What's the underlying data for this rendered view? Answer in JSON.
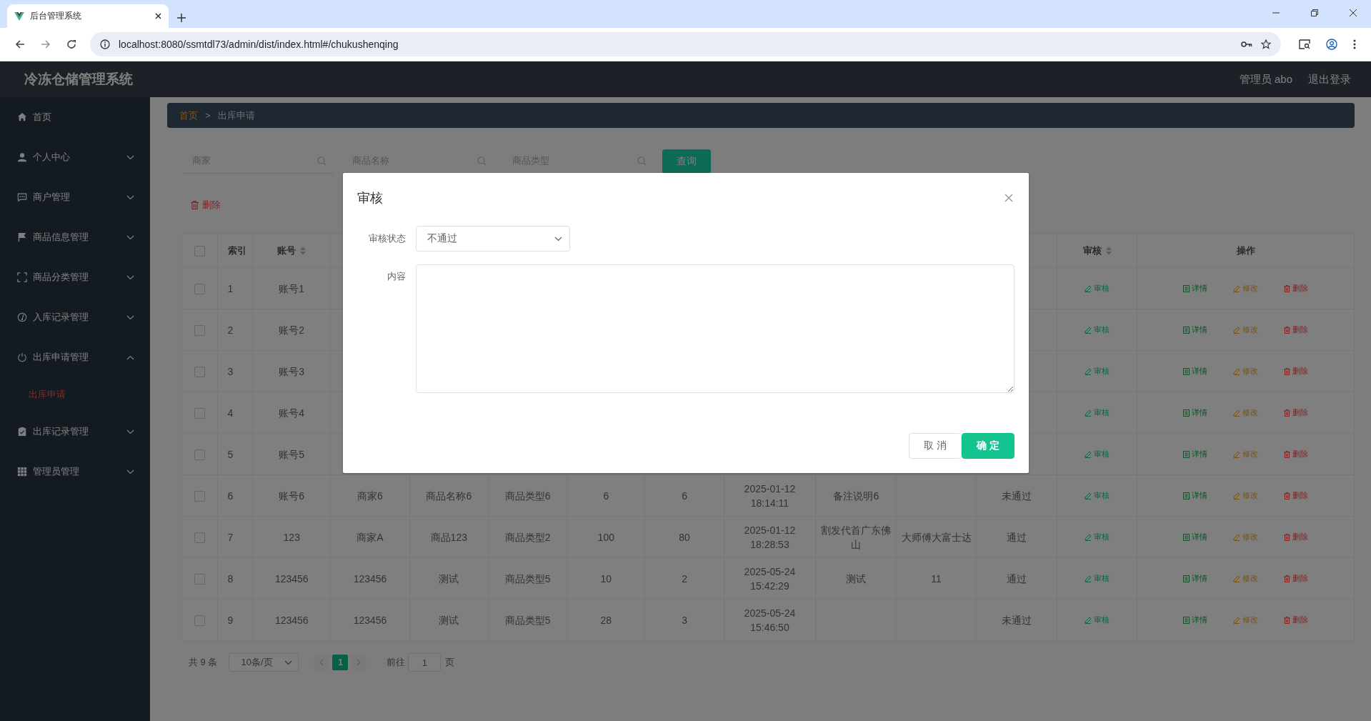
{
  "browser": {
    "tab_title": "后台管理系统",
    "url": "localhost:8080/ssmtdl73/admin/dist/index.html#/chukushenqing"
  },
  "header": {
    "title": "冷冻仓储管理系统",
    "user": "管理员 abo",
    "logout": "退出登录"
  },
  "sidebar": {
    "items": [
      {
        "label": "首页",
        "kind": "link"
      },
      {
        "label": "个人中心",
        "kind": "menu",
        "expanded": false
      },
      {
        "label": "商户管理",
        "kind": "menu",
        "expanded": false
      },
      {
        "label": "商品信息管理",
        "kind": "menu",
        "expanded": false
      },
      {
        "label": "商品分类管理",
        "kind": "menu",
        "expanded": false
      },
      {
        "label": "入库记录管理",
        "kind": "menu",
        "expanded": false
      },
      {
        "label": "出库申请管理",
        "kind": "menu",
        "expanded": true,
        "children": [
          {
            "label": "出库申请",
            "selected": true
          }
        ]
      },
      {
        "label": "出库记录管理",
        "kind": "menu",
        "expanded": false
      },
      {
        "label": "管理员管理",
        "kind": "menu",
        "expanded": false
      }
    ]
  },
  "breadcrumb": {
    "separator": ">",
    "items": [
      {
        "label": "首页",
        "selected": false
      },
      {
        "label": "出库申请",
        "selected": true
      }
    ]
  },
  "search": {
    "fields": [
      {
        "placeholder": "商家"
      },
      {
        "placeholder": "商品名称"
      },
      {
        "placeholder": "商品类型"
      }
    ],
    "button": "查询"
  },
  "toolbar": {
    "delete": "删除"
  },
  "table": {
    "header_checked": false,
    "columns": [
      {
        "label": "索引",
        "sortable": false
      },
      {
        "label": "账号",
        "sortable": true
      }
    ],
    "trailing_columns": [
      {
        "label": "审核",
        "sortable": true
      },
      {
        "label": "操作",
        "sortable": false
      }
    ],
    "rows": [
      {
        "checked": false,
        "cells": [
          "1",
          "账号1"
        ],
        "review": "审核",
        "actions": [
          {
            "kind": "detail",
            "label": "详情"
          },
          {
            "kind": "edit",
            "label": "修改"
          },
          {
            "kind": "delete",
            "label": "删除"
          }
        ]
      },
      {
        "checked": false,
        "cells": [
          "2",
          "账号2"
        ],
        "review": "审核",
        "actions": [
          {
            "kind": "detail",
            "label": "详情"
          },
          {
            "kind": "edit",
            "label": "修改"
          },
          {
            "kind": "delete",
            "label": "删除"
          }
        ]
      },
      {
        "checked": false,
        "cells": [
          "3",
          "账号3"
        ],
        "review": "审核",
        "actions": [
          {
            "kind": "detail",
            "label": "详情"
          },
          {
            "kind": "edit",
            "label": "修改"
          },
          {
            "kind": "delete",
            "label": "删除"
          }
        ]
      },
      {
        "checked": false,
        "cells": [
          "4",
          "账号4"
        ],
        "review": "审核",
        "actions": [
          {
            "kind": "detail",
            "label": "详情"
          },
          {
            "kind": "edit",
            "label": "修改"
          },
          {
            "kind": "delete",
            "label": "删除"
          }
        ]
      },
      {
        "checked": false,
        "cells": [
          "5",
          "账号5"
        ],
        "review": "审核",
        "actions": [
          {
            "kind": "detail",
            "label": "详情"
          },
          {
            "kind": "edit",
            "label": "修改"
          },
          {
            "kind": "delete",
            "label": "删除"
          }
        ]
      },
      {
        "checked": false,
        "cells": [
          "6",
          "账号6",
          "商家6",
          "商品名称6",
          "商品类型6",
          "6",
          "6",
          "2025-01-12 18:14:11",
          "备注说明6"
        ],
        "status": "未通过",
        "review": "审核",
        "actions": [
          {
            "kind": "detail",
            "label": "详情"
          },
          {
            "kind": "edit",
            "label": "修改"
          },
          {
            "kind": "delete",
            "label": "删除"
          }
        ]
      },
      {
        "checked": false,
        "cells": [
          "7",
          "123",
          "商家A",
          "商品123",
          "商品类型2",
          "100",
          "80",
          "2025-01-12 18:28:53",
          "割发代首广东佛山",
          "大师傅大富士达"
        ],
        "status": "通过",
        "review": "审核",
        "actions": [
          {
            "kind": "detail",
            "label": "详情"
          },
          {
            "kind": "edit",
            "label": "修改"
          },
          {
            "kind": "delete",
            "label": "删除"
          }
        ]
      },
      {
        "checked": false,
        "cells": [
          "8",
          "123456",
          "123456",
          "测试",
          "商品类型5",
          "10",
          "2",
          "2025-05-24 15:42:29",
          "测试",
          "11"
        ],
        "status": "通过",
        "review": "审核",
        "actions": [
          {
            "kind": "detail",
            "label": "详情"
          },
          {
            "kind": "edit",
            "label": "修改"
          },
          {
            "kind": "delete",
            "label": "删除"
          }
        ]
      },
      {
        "checked": false,
        "cells": [
          "9",
          "123456",
          "123456",
          "测试",
          "商品类型5",
          "28",
          "3",
          "2025-05-24 15:46:50"
        ],
        "status": "未通过",
        "review": "审核",
        "actions": [
          {
            "kind": "detail",
            "label": "详情"
          },
          {
            "kind": "edit",
            "label": "修改"
          },
          {
            "kind": "delete",
            "label": "删除"
          }
        ]
      }
    ]
  },
  "pagination": {
    "total": "共 9 条",
    "page_size": "10条/页",
    "pages": [
      {
        "label": "1",
        "selected": true
      }
    ],
    "goto_label": "前往",
    "goto_value": "1",
    "goto_suffix": "页"
  },
  "modal": {
    "title": "审核",
    "status_label": "审核状态",
    "status_value": "不通过",
    "content_label": "内容",
    "buttons": [
      {
        "kind": "cancel",
        "label": "取 消"
      },
      {
        "kind": "primary",
        "label": "确 定"
      }
    ]
  }
}
